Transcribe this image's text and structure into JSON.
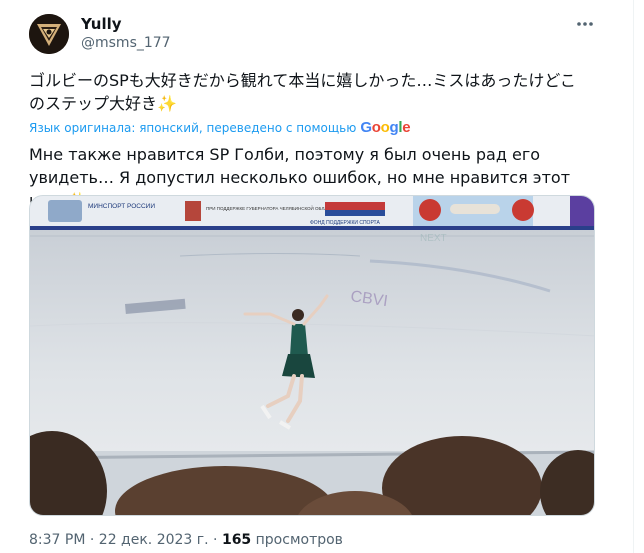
{
  "author": {
    "name": "Yully",
    "handle": "@msms_177"
  },
  "tweet": {
    "original_text": "ゴルビーのSPも大好きだから観れて本当に嬉しかった…ミスはあったけどこのステップ大好き",
    "translation_note": "Язык оригинала: японский, переведено с помощью",
    "translator": "Google",
    "translated_text": "Мне также нравится SP Голби, поэтому я был очень рад его увидеть… Я допустил несколько ошибок, но мне нравится этот шаг",
    "emoji": "✨"
  },
  "media": {
    "banner_sponsor_1": "МИНСПОРТ РОССИИ",
    "banner_sponsor_2": "ПРИ ПОДДЕРЖКЕ ГУБЕРНАТОРА ЧЕЛЯБИНСКОЙ ОБЛАСТИ",
    "banner_sponsor_3": "ФОНД ПОДДЕРЖКИ СПОРТА"
  },
  "meta": {
    "time": "8:37 PM",
    "date": "22 дек. 2023 г.",
    "views_count": "165",
    "views_label": "просмотров",
    "separator": "·"
  },
  "icons": {
    "more": "more-options-icon"
  }
}
